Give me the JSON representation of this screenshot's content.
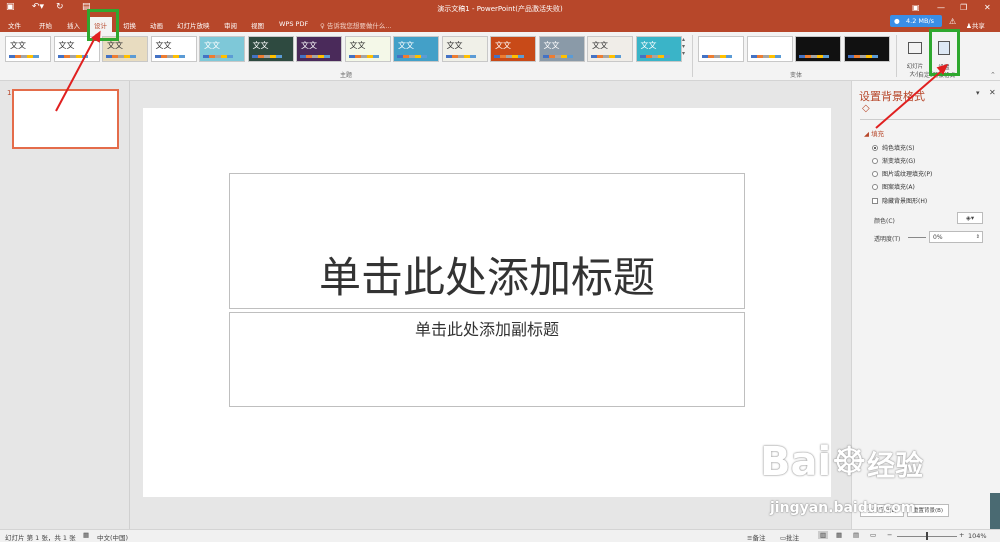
{
  "window": {
    "title": "演示文稿1 - PowerPoint(产品激活失败)"
  },
  "tabs": [
    "文件",
    "开始",
    "插入",
    "设计",
    "切换",
    "动画",
    "幻灯片放映",
    "审阅",
    "视图",
    "WPS PDF"
  ],
  "tell_me": {
    "placeholder": "告诉我您想要做什么..."
  },
  "network_badge": "4.2 MB/s",
  "share_label": "共享",
  "ribbon": {
    "theme_sample_text": "文文",
    "themes_group_label": "主题",
    "variants_group_label": "变体",
    "customize_group_label": "自定义",
    "slide_size_label": "幻灯片\n大小",
    "format_bg_label": "设置\n背景格式",
    "theme_colors": [
      "#ffffff",
      "#ffffff",
      "#e8dcc0",
      "#ffffff",
      "#7ec8d8",
      "#2e4a40",
      "#4a2a5a",
      "#f4f8e8",
      "#43a0c8",
      "#f0f0e8",
      "#c84a18",
      "#8a9aa8",
      "#f0ede8",
      "#3ab4c8"
    ],
    "variant_colors": [
      "#ffffff",
      "#ffffff",
      "#111111",
      "#111111"
    ]
  },
  "slides_panel": {
    "slide_number": "1"
  },
  "slide": {
    "title_placeholder": "单击此处添加标题",
    "subtitle_placeholder": "单击此处添加副标题"
  },
  "format_pane": {
    "title": "设置背景格式",
    "section": "填充",
    "options": [
      {
        "label": "纯色填充(S)",
        "selected": true
      },
      {
        "label": "渐变填充(G)",
        "selected": false
      },
      {
        "label": "图片或纹理填充(P)",
        "selected": false
      },
      {
        "label": "图案填充(A)",
        "selected": false
      }
    ],
    "hide_bg_label": "隐藏背景图形(H)",
    "color_label": "颜色(C)",
    "transparency_label": "透明度(T)",
    "transparency_value": "0%",
    "reset_button": "重置背景(B)",
    "apply_all_button": "全部应用(L)"
  },
  "status": {
    "slide_info": "幻灯片 第 1 张，共 1 张",
    "language": "中文(中国)",
    "notes": "备注",
    "comments": "批注",
    "zoom": "104%"
  },
  "watermark": {
    "brand": "Bai",
    "brand2": "经验",
    "url": "jingyan.baidu.com"
  },
  "accent_color": "#b7472a"
}
